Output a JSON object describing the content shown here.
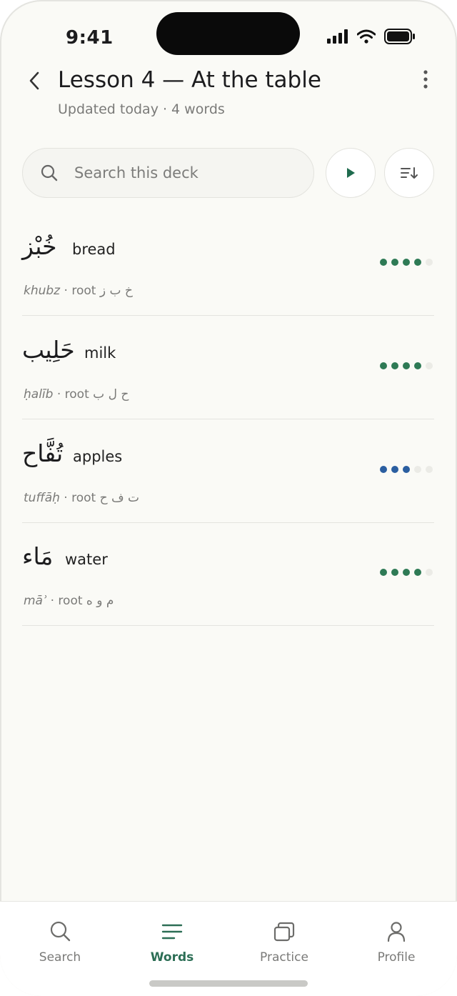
{
  "status": {
    "time": "9:41"
  },
  "header": {
    "title": "Lesson 4 — At the table",
    "subtitle": "Updated today · 4 words"
  },
  "search": {
    "placeholder": "Search this deck"
  },
  "colors": {
    "green": "#2e7a55",
    "blue": "#2a5ea0",
    "dot_empty": "#ebebe6",
    "accent": "#2c6e55"
  },
  "words": [
    {
      "arabic": "خُبْز",
      "english": "bread",
      "translit": "khubz",
      "root_label": "root",
      "root": "خ ب ز",
      "progress": 4,
      "max": 5,
      "color": "green"
    },
    {
      "arabic": "حَلِيب",
      "english": "milk",
      "translit": "ḥalīb",
      "root_label": "root",
      "root": "ح ل ب",
      "progress": 4,
      "max": 5,
      "color": "green"
    },
    {
      "arabic": "تُفَّاح",
      "english": "apples",
      "translit": "tuffāḥ",
      "root_label": "root",
      "root": "ت ف ح",
      "progress": 3,
      "max": 5,
      "color": "blue"
    },
    {
      "arabic": "مَاء",
      "english": "water",
      "translit": "māʾ",
      "root_label": "root",
      "root": "م و ه",
      "progress": 4,
      "max": 5,
      "color": "green"
    }
  ],
  "tabs": [
    {
      "label": "Search",
      "icon": "search-icon",
      "active": false
    },
    {
      "label": "Words",
      "icon": "list-icon",
      "active": true
    },
    {
      "label": "Practice",
      "icon": "cards-icon",
      "active": false
    },
    {
      "label": "Profile",
      "icon": "person-icon",
      "active": false
    }
  ]
}
